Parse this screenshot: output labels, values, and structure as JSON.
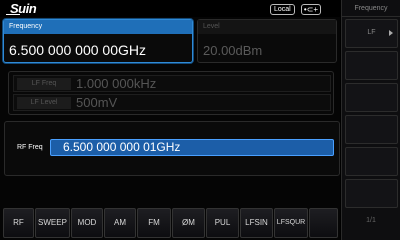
{
  "header": {
    "logo": "Suin",
    "local_badge": "Local",
    "usb_badge": "•⊂+"
  },
  "frequency_panel": {
    "title": "Frequency",
    "value": "6.500 000 000 00GHz"
  },
  "level_panel": {
    "title": "Level",
    "value": "20.00dBm"
  },
  "lf": {
    "freq_label": "LF Freq",
    "freq_value": "1.000 000kHz",
    "level_label": "LF Level",
    "level_value": "500mV"
  },
  "rf": {
    "label": "RF Freq",
    "input_value": "6.500 000 000 01GHz"
  },
  "tabs": [
    {
      "label": "RF"
    },
    {
      "label": "SWEEP"
    },
    {
      "label": "MOD"
    },
    {
      "label": "AM"
    },
    {
      "label": "FM"
    },
    {
      "label": "ØM"
    },
    {
      "label": "PUL"
    },
    {
      "label": "LFSIN"
    },
    {
      "label": "LFSQUR"
    },
    {
      "label": ""
    }
  ],
  "right_panel": {
    "title": "Frequency",
    "softkeys": [
      {
        "label": "LF"
      },
      {
        "label": ""
      },
      {
        "label": ""
      },
      {
        "label": ""
      },
      {
        "label": ""
      },
      {
        "label": ""
      }
    ],
    "page_indicator": "1/1"
  },
  "colors": {
    "accent": "#1f6fb8",
    "input_bg": "#1c5ea8",
    "dim_text": "#555555"
  }
}
